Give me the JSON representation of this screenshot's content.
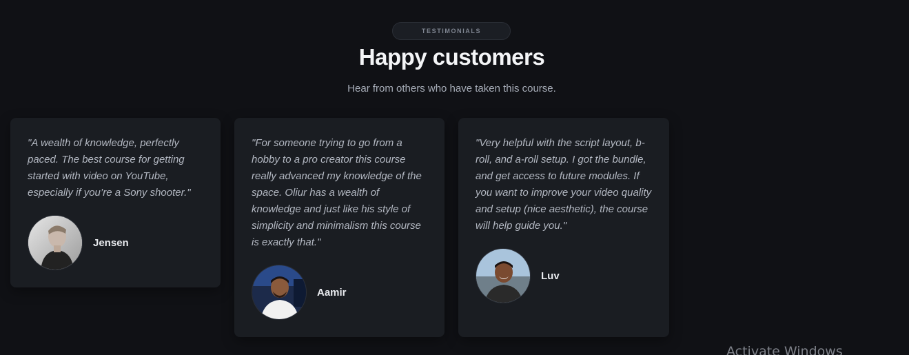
{
  "section": {
    "badge": "TESTIMONIALS",
    "title": "Happy customers",
    "subtitle": "Hear from others who have taken this course."
  },
  "testimonials": [
    {
      "quote": "\"A wealth of knowledge, perfectly paced. The best course for getting started with video on YouTube, especially if you’re a Sony shooter.\"",
      "name": "Jensen",
      "avatar_icon": "person-photo"
    },
    {
      "quote": "\"For someone trying to go from a hobby to a pro creator this course really advanced my knowledge of the space. Oliur has a wealth of knowledge and just like his style of simplicity and minimalism this course is exactly that.\"",
      "name": "Aamir",
      "avatar_icon": "person-photo"
    },
    {
      "quote": "\"Very helpful with the script layout, b-roll, and a-roll setup. I got the bundle, and get access to future modules. If you want to improve your video quality and setup (nice aesthetic), the course will help guide you.\"",
      "name": "Luv",
      "avatar_icon": "person-photo"
    }
  ],
  "overlay": {
    "watermark": "Activate Windows"
  },
  "colors": {
    "background": "#101115",
    "card": "#1a1d22",
    "quote_text": "#b3b8c2",
    "heading": "#f4f5f7"
  }
}
